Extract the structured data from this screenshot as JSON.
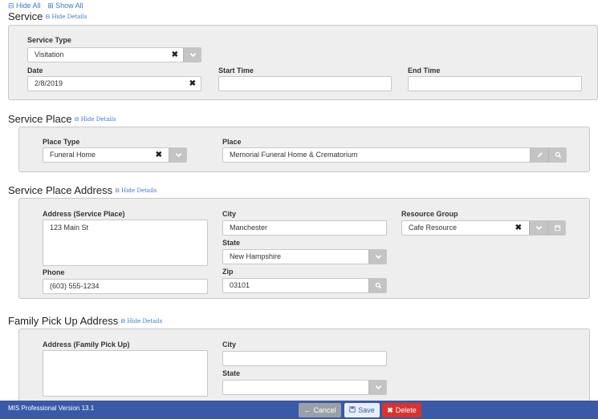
{
  "top": {
    "hide_all": "⊟ Hide All",
    "show_all": "⊞ Show All"
  },
  "hide_details": "⊟ Hide Details",
  "service": {
    "title": "Service",
    "service_type_label": "Service Type",
    "service_type_value": "Visitation",
    "date_label": "Date",
    "date_value": "2/8/2019",
    "start_time_label": "Start Time",
    "start_time_value": "",
    "end_time_label": "End Time",
    "end_time_value": ""
  },
  "service_place": {
    "title": "Service Place",
    "place_type_label": "Place Type",
    "place_type_value": "Funeral Home",
    "place_label": "Place",
    "place_value": "Memorial Funeral Home & Crematorium"
  },
  "service_place_address": {
    "title": "Service Place Address",
    "address_label": "Address (Service Place)",
    "address_value": "123 Main St",
    "city_label": "City",
    "city_value": "Manchester",
    "state_label": "State",
    "state_value": "New Hampshire",
    "zip_label": "Zip",
    "zip_value": "03101",
    "phone_label": "Phone",
    "phone_value": "(603) 555-1234",
    "resource_group_label": "Resource Group",
    "resource_group_value": "Cafe Resource"
  },
  "family_pickup": {
    "title": "Family Pick Up Address",
    "address_label": "Address (Family Pick Up)",
    "address_value": "",
    "city_label": "City",
    "city_value": "",
    "state_label": "State",
    "state_value": ""
  },
  "footer": {
    "version": "MIS Professional Version 13.1",
    "cancel": "Cancel",
    "save": "Save",
    "delete": "Delete"
  },
  "colors": {
    "footer_bg": "#3a5aa8",
    "link": "#3a7bc8",
    "delete": "#d9332e",
    "panel_bg": "#eeeeee"
  }
}
